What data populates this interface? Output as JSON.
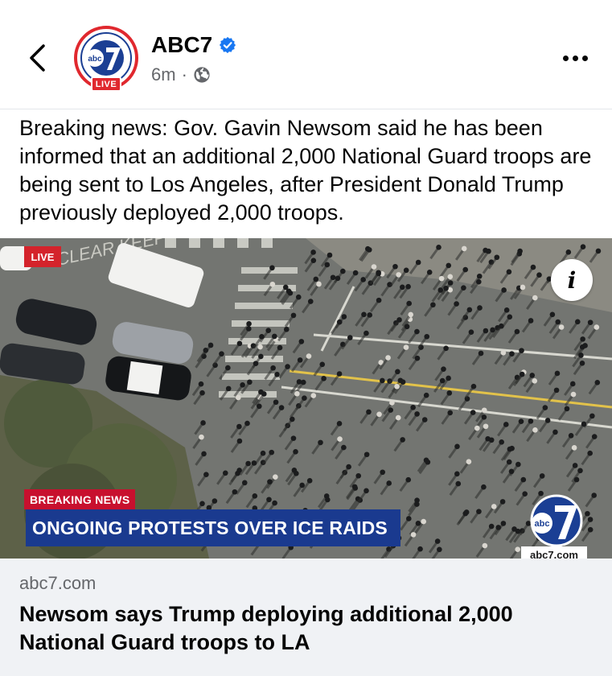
{
  "header": {
    "page_name": "ABC7",
    "time": "6m",
    "separator": "·",
    "avatar_live": "LIVE",
    "back_icon": "chevron-left-icon",
    "verified_icon": "verified-badge-icon",
    "privacy_icon": "globe-icon",
    "more_icon": "more-horizontal-icon",
    "accent_color": "#1877f2"
  },
  "post": {
    "text": "Breaking news: Gov. Gavin Newsom said he has been informed that an additional 2,000 National Guard troops are being sent to Los Angeles, after President Donald Trump previously deployed 2,000 troops."
  },
  "media": {
    "live_badge": "LIVE",
    "breaking_label": "BREAKING NEWS",
    "headline": "ONGOING PROTESTS OVER ICE RAIDS",
    "watermark_url": "abc7.com",
    "info_label": "i",
    "road_text": "CLEAR KEEP"
  },
  "link": {
    "domain": "abc7.com",
    "title": "Newsom says Trump deploying additional 2,000 National Guard troops to LA"
  }
}
